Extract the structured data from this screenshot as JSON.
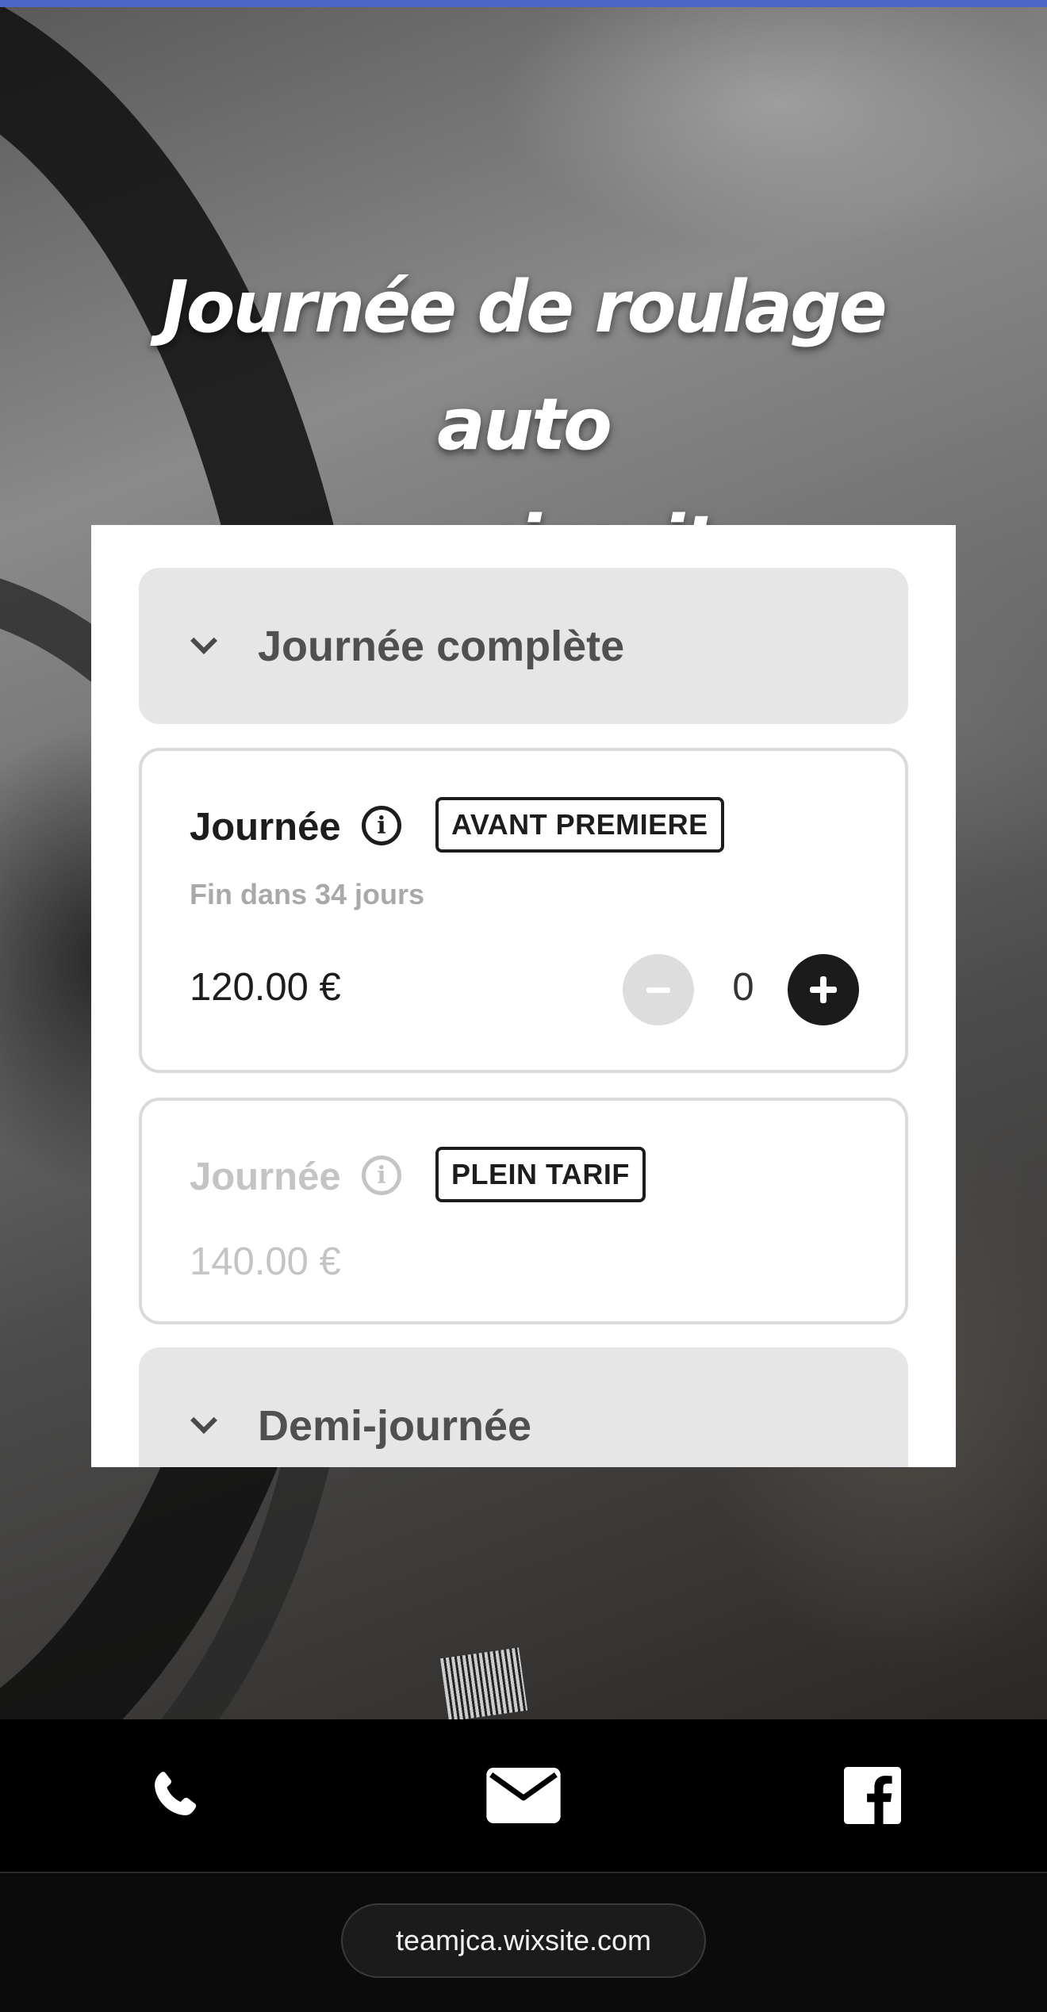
{
  "hero": {
    "title_line1": "Journée de roulage auto",
    "title_line2": "sur circuit"
  },
  "groups": [
    {
      "label": "Journée complète",
      "icon": "chevron-down-icon"
    },
    {
      "label": "Demi-journée",
      "icon": "chevron-down-icon"
    }
  ],
  "tickets": [
    {
      "name": "Journée",
      "badge": "AVANT PREMIERE",
      "subtitle": "Fin dans 34 jours",
      "price": "120.00 €",
      "quantity": "0",
      "minus_label": "−",
      "plus_label": "+"
    },
    {
      "name": "Journée",
      "badge": "PLEIN TARIF",
      "price": "140.00 €"
    }
  ],
  "info_glyph": "i",
  "footer": {
    "items": [
      {
        "icon": "phone-icon"
      },
      {
        "icon": "mail-icon"
      },
      {
        "icon": "facebook-icon"
      }
    ]
  },
  "browser": {
    "url": "teamjca.wixsite.com"
  },
  "colors": {
    "accent_line": "#4b66c5",
    "panel_bg": "#ffffff",
    "group_bg": "#e6e6e6",
    "text_dark": "#1d1d1d",
    "text_muted": "#a9a9a9",
    "footer_bg": "#000000"
  }
}
